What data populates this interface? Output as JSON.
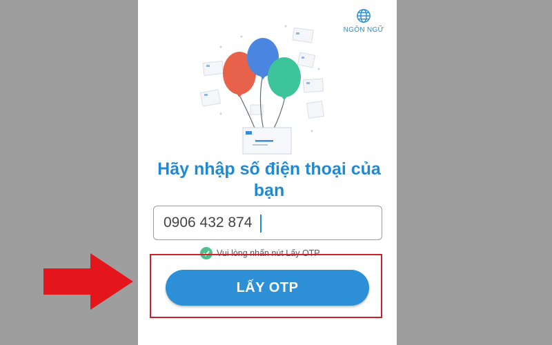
{
  "header": {
    "language_label": "NGÔN NGỮ"
  },
  "main": {
    "title": "Hãy nhập số điện thoại của bạn",
    "phone_value": "0906 432 874",
    "hint_text": "Vui lòng nhấn nút Lấy OTP",
    "otp_button_label": "LẤY OTP"
  },
  "colors": {
    "accent": "#1f8ad2",
    "button": "#2d8fd5",
    "highlight": "#d11f2a",
    "check": "#4fc08d",
    "backdrop": "#9e9e9e"
  },
  "icons": {
    "language": "globe-icon",
    "hint": "check-circle-icon",
    "pointer": "red-arrow-icon"
  }
}
